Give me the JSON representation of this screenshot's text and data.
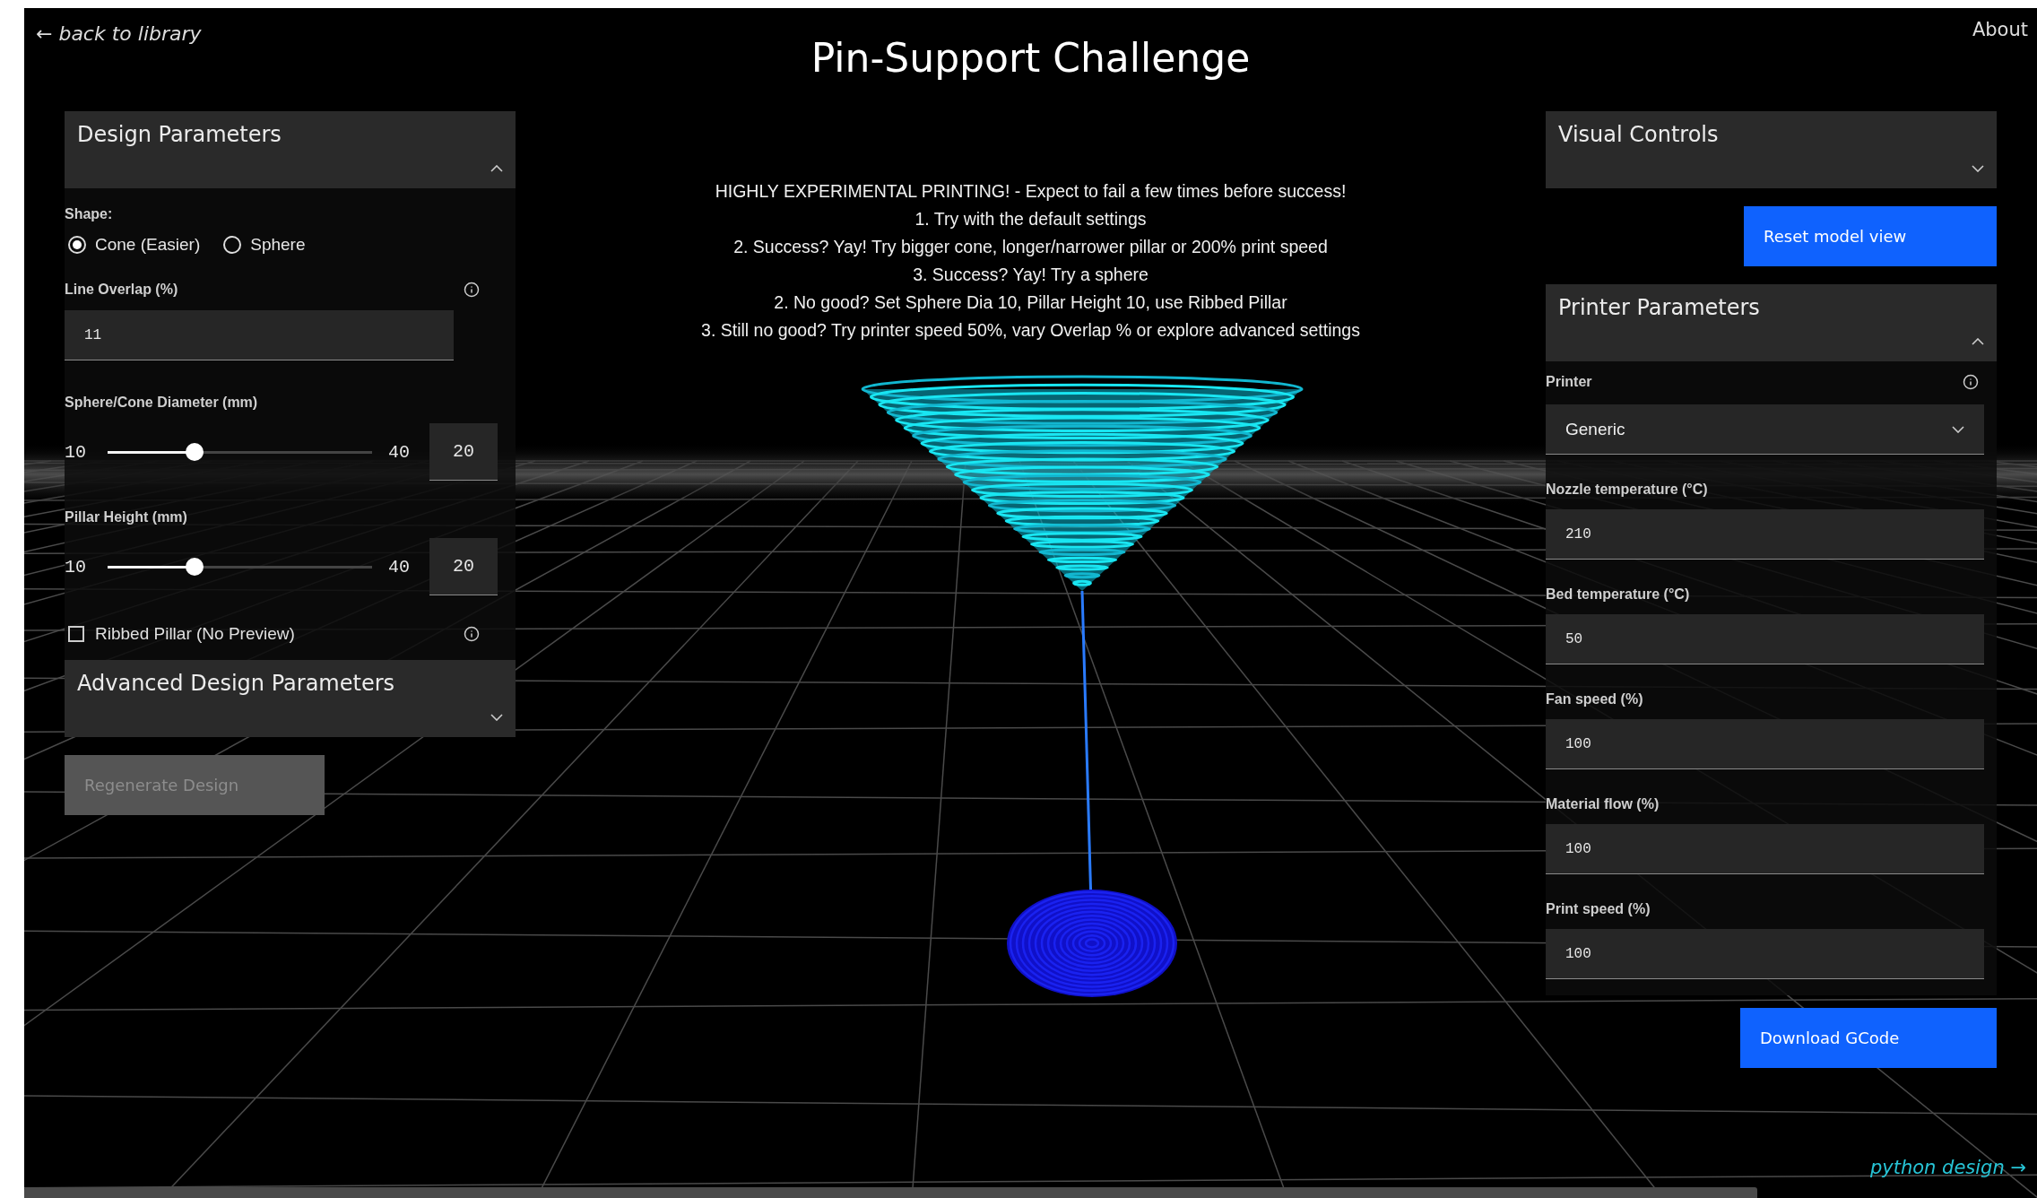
{
  "nav": {
    "back_link": "← back to library",
    "about_link": "About"
  },
  "title": "Pin-Support Challenge",
  "instructions": [
    "HIGHLY EXPERIMENTAL PRINTING! - Expect to fail a few times before success!",
    "1. Try with the default settings",
    "2. Success? Yay! Try bigger cone, longer/narrower pillar or 200% print speed",
    "3. Success? Yay! Try a sphere",
    "2. No good? Set Sphere Dia 10, Pillar Height 10, use Ribbed Pillar",
    "3. Still no good? Try printer speed 50%, vary Overlap % or explore advanced settings"
  ],
  "left_panel": {
    "design_section": {
      "title": "Design Parameters",
      "expanded": true
    },
    "shape": {
      "label": "Shape:",
      "options": [
        {
          "label": "Cone (Easier)",
          "selected": true
        },
        {
          "label": "Sphere",
          "selected": false
        }
      ]
    },
    "line_overlap": {
      "label": "Line Overlap (%)",
      "value": "11"
    },
    "sliders": [
      {
        "label": "Sphere/Cone Diameter (mm)",
        "min": "10",
        "max": "40",
        "value": "20",
        "level": 0.33
      },
      {
        "label": "Pillar Height (mm)",
        "min": "10",
        "max": "40",
        "value": "20",
        "level": 0.33
      }
    ],
    "ribbed_pillar": {
      "label": "Ribbed Pillar (No Preview)",
      "checked": false
    },
    "advanced_section": {
      "title": "Advanced Design Parameters",
      "expanded": false
    },
    "regenerate_button": {
      "label": "Regenerate Design",
      "disabled": true
    }
  },
  "right_panel": {
    "visual_section": {
      "title": "Visual Controls",
      "expanded": false
    },
    "reset_button": "Reset model view",
    "printer_section": {
      "title": "Printer Parameters",
      "expanded": true
    },
    "printer": {
      "label": "Printer",
      "value": "Generic"
    },
    "fields": [
      {
        "label": "Nozzle temperature (°C)",
        "value": "210"
      },
      {
        "label": "Bed temperature (°C)",
        "value": "50"
      },
      {
        "label": "Fan speed (%)",
        "value": "100"
      },
      {
        "label": "Material flow (%)",
        "value": "100"
      },
      {
        "label": "Print speed (%)",
        "value": "100"
      }
    ],
    "download_button": "Download GCode"
  },
  "footer_link": "python design →"
}
